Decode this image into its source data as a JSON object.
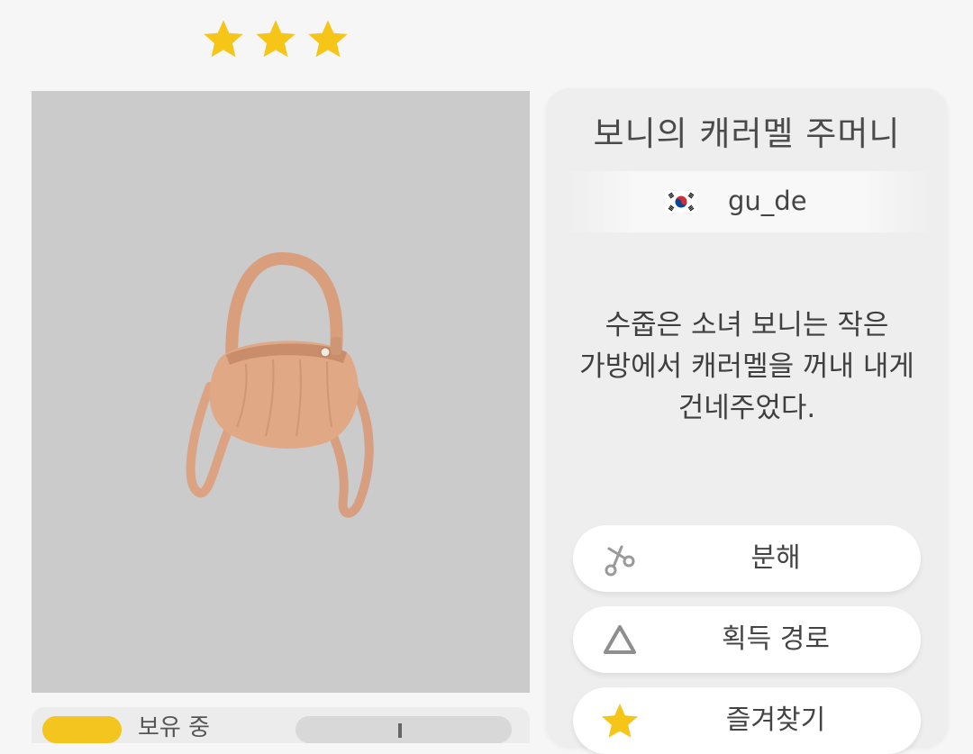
{
  "rating": {
    "stars": 3,
    "star_color": "#f5c518"
  },
  "item": {
    "title": "보니의 캐러멜 주머니",
    "designer": "gu_de",
    "designer_flag": "south-korea-flag-icon",
    "description": "수줍은 소녀 보니는 작은\n가방에서 캐러멜을 꺼내 내게\n건네주었다."
  },
  "actions": {
    "disassemble_label": "분해",
    "acquire_label": "획득 경로",
    "favorite_label": "즐겨찾기"
  },
  "bottom": {
    "owned_label": "보유 중"
  },
  "colors": {
    "image_bg": "#cbcbcb",
    "card_bg": "#eeeeee",
    "accent": "#f3c51e"
  }
}
